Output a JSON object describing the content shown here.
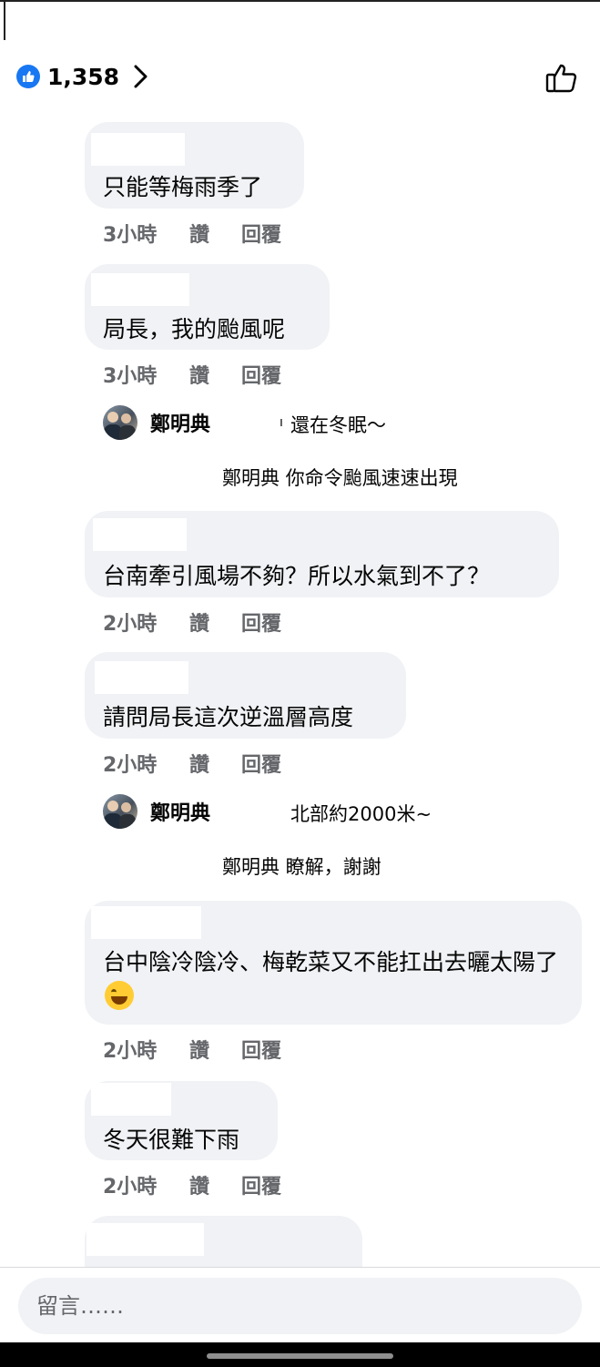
{
  "header": {
    "reaction_count": "1,358",
    "like_color": "#1877f2"
  },
  "comments": [
    {
      "text": "只能等梅雨季了",
      "time": "3小時",
      "like_label": "讚",
      "reply_label": "回覆"
    },
    {
      "text": "局長，我的颱風呢",
      "time": "3小時",
      "like_label": "讚",
      "reply_label": "回覆"
    },
    {
      "text": "台南牽引風場不夠？所以水氣到不了？",
      "time": "2小時",
      "like_label": "讚",
      "reply_label": "回覆"
    },
    {
      "text": "請問局長這次逆溫層高度",
      "time": "2小時",
      "like_label": "讚",
      "reply_label": "回覆"
    },
    {
      "text": "台中陰冷陰冷、梅乾菜又不能扛出去曬太陽了",
      "emoji": "grinning-sweat-emoji",
      "time": "2小時",
      "like_label": "讚",
      "reply_label": "回覆"
    },
    {
      "text": "冬天很難下雨",
      "time": "2小時",
      "like_label": "讚",
      "reply_label": "回覆"
    }
  ],
  "replies": [
    {
      "name": "鄭明典",
      "text": "還在冬眠～",
      "subreply": "鄭明典 你命令颱風速速出現"
    },
    {
      "name": "鄭明典",
      "text": "北部約2000米~",
      "subreply": "鄭明典 瞭解，謝謝"
    }
  ],
  "composer": {
    "placeholder": "留言……"
  },
  "icons": {
    "reaction": "like-reaction-icon",
    "more": "chevron-right-icon",
    "like_button": "thumbs-up-outline-icon"
  }
}
